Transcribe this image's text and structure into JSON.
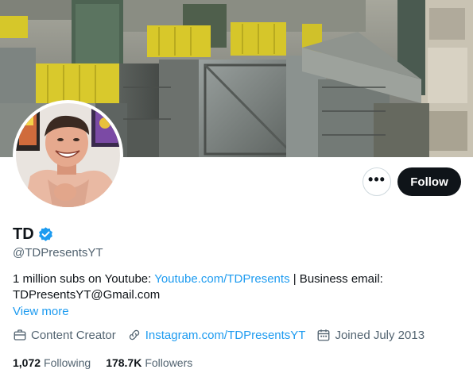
{
  "profile": {
    "name": "TD",
    "handle": "@TDPresentsYT",
    "bio_prefix": "1 million subs on Youtube: ",
    "bio_link": "Youtube.com/TDPresents",
    "bio_middle": " | Business email:",
    "bio_email": "TDPresentsYT@Gmail.com",
    "view_more": "View more",
    "verified": true
  },
  "actions": {
    "more_icon": "more-horizontal-icon",
    "more_label": "•••",
    "follow_label": "Follow"
  },
  "meta": {
    "category": "Content Creator",
    "category_icon": "briefcase-icon",
    "website": "Instagram.com/TDPresentsYT",
    "website_icon": "link-icon",
    "joined": "Joined July 2013",
    "joined_icon": "calendar-icon"
  },
  "stats": {
    "following_count": "1,072",
    "following_label": "Following",
    "followers_count": "178.7K",
    "followers_label": "Followers"
  },
  "colors": {
    "accent": "#1d9bf0",
    "text": "#0f1419",
    "muted": "#536471",
    "button_dark": "#0f1419"
  }
}
